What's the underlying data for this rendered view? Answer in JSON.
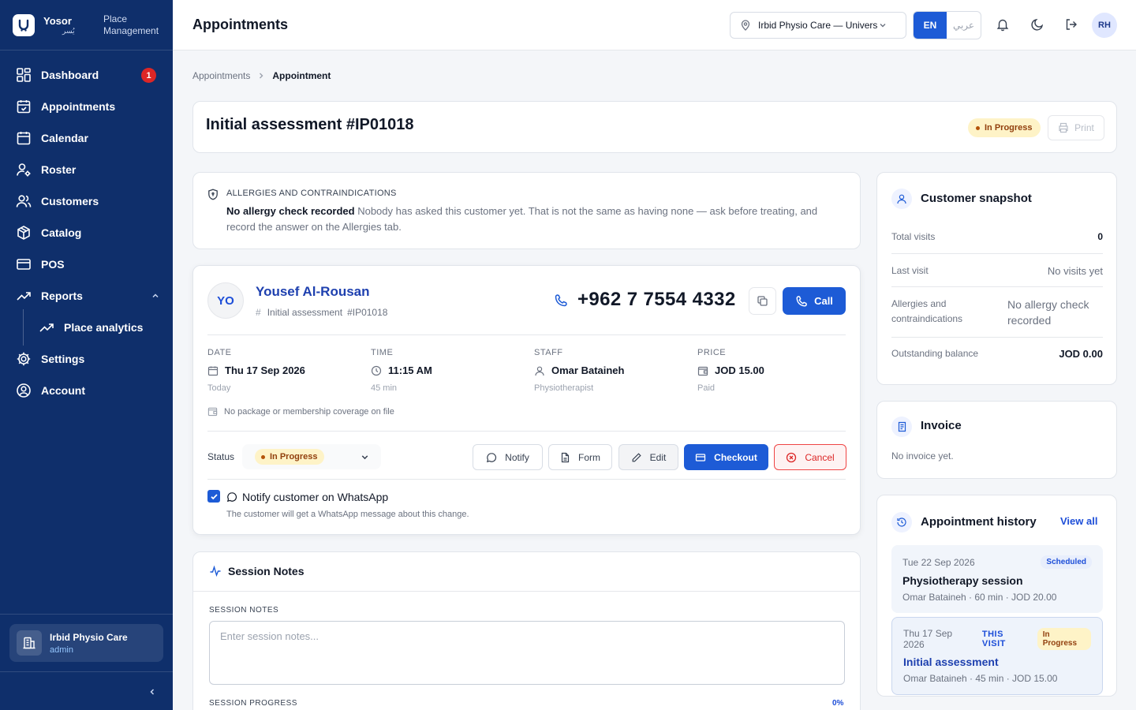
{
  "sidebar": {
    "brand_name": "Yosor",
    "brand_name_ar": "يُسر",
    "brand_subtitle": "Place Management",
    "items": [
      {
        "label": "Dashboard",
        "icon": "dashboard-icon",
        "badge": "1"
      },
      {
        "label": "Appointments",
        "icon": "calendar-check-icon"
      },
      {
        "label": "Calendar",
        "icon": "calendar-icon"
      },
      {
        "label": "Roster",
        "icon": "user-gear-icon"
      },
      {
        "label": "Customers",
        "icon": "users-icon"
      },
      {
        "label": "Catalog",
        "icon": "box-icon"
      },
      {
        "label": "POS",
        "icon": "card-icon"
      },
      {
        "label": "Reports",
        "icon": "trending-icon",
        "expanded": true
      },
      {
        "label": "Place analytics",
        "icon": "trending-icon"
      },
      {
        "label": "Settings",
        "icon": "gear-icon"
      },
      {
        "label": "Account",
        "icon": "user-circle-icon"
      }
    ],
    "place": {
      "name": "Irbid Physio Care",
      "role": "admin"
    }
  },
  "header": {
    "title": "Appointments",
    "location": "Irbid Physio Care — University",
    "lang_en": "EN",
    "lang_ar": "عربي",
    "avatar": "RH"
  },
  "breadcrumb": {
    "parent": "Appointments",
    "current": "Appointment"
  },
  "appointment": {
    "title": "Initial assessment #IP01018",
    "status": "In Progress",
    "print_label": "Print"
  },
  "allergy": {
    "label": "ALLERGIES AND CONTRAINDICATIONS",
    "headline": "No allergy check recorded",
    "text": "Nobody has asked this customer yet. That is not the same as having none — ask before treating, and record the answer on the Allergies tab."
  },
  "customer": {
    "initials": "YO",
    "name": "Yousef Al-Rousan",
    "service": "Initial assessment",
    "ref": "#IP01018",
    "phone": "+962 7 7554 4332",
    "call_label": "Call"
  },
  "details": {
    "date": {
      "label": "DATE",
      "value": "Thu 17 Sep 2026",
      "sub": "Today"
    },
    "time": {
      "label": "TIME",
      "value": "11:15 AM",
      "sub": "45 min"
    },
    "staff": {
      "label": "STAFF",
      "value": "Omar Bataineh",
      "sub": "Physiotherapist"
    },
    "price": {
      "label": "PRICE",
      "value": "JOD 15.00",
      "sub": "Paid"
    },
    "coverage": "No package or membership coverage on file"
  },
  "actions": {
    "status_label": "Status",
    "status_value": "In Progress",
    "notify": "Notify",
    "form": "Form",
    "edit": "Edit",
    "checkout": "Checkout",
    "cancel": "Cancel",
    "whatsapp_label": "Notify customer on WhatsApp",
    "whatsapp_checked": true,
    "whatsapp_help": "The customer will get a WhatsApp message about this change."
  },
  "notes": {
    "title": "Session Notes",
    "notes_label": "SESSION NOTES",
    "notes_placeholder": "Enter session notes...",
    "progress_label": "SESSION PROGRESS",
    "progress_value": "0%"
  },
  "snapshot": {
    "title": "Customer snapshot",
    "rows": [
      {
        "label": "Total visits",
        "value": "0"
      },
      {
        "label": "Last visit",
        "value": "No visits yet"
      },
      {
        "label": "Allergies and contraindications",
        "value": "No allergy check recorded"
      },
      {
        "label": "Outstanding balance",
        "value": "JOD 0.00"
      }
    ]
  },
  "invoice": {
    "title": "Invoice",
    "empty": "No invoice yet."
  },
  "history": {
    "title": "Appointment history",
    "view_all": "View all",
    "items": [
      {
        "date": "Tue 22 Sep 2026",
        "tag": "Scheduled",
        "name": "Physiotherapy session",
        "meta": "Omar Bataineh · 60 min · JOD 20.00"
      },
      {
        "date": "Thu 17 Sep 2026",
        "this": "THIS VISIT",
        "tag": "In Progress",
        "name": "Initial assessment",
        "meta": "Omar Bataineh · 45 min · JOD 15.00"
      }
    ]
  },
  "colors": {
    "sidebar": "#0f2f6b",
    "primary": "#1d5bd6",
    "danger": "#dc2626",
    "warning_bg": "#fef3c7"
  }
}
